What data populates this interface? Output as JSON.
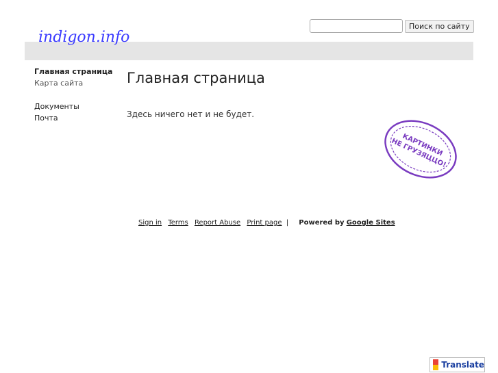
{
  "header": {
    "logo": "indigon.info",
    "search_placeholder": "",
    "search_button": "Поиск по сайту"
  },
  "sidebar": {
    "items": [
      {
        "label": "Главная страница"
      },
      {
        "label": "Карта сайта"
      },
      {
        "label": "Документы"
      },
      {
        "label": "Почта"
      }
    ]
  },
  "main": {
    "title": "Главная страница",
    "text": "Здесь ничего нет и не будет.",
    "stamp_line1": "КАРТИНКИ",
    "stamp_line2": "НЕ ГРУЗЯЦЦО!"
  },
  "footer": {
    "sign_in": "Sign in",
    "terms": "Terms",
    "report_abuse": "Report Abuse",
    "print_page": "Print page",
    "separator": "|",
    "powered_by": "Powered by",
    "google_sites": "Google Sites"
  },
  "translate": {
    "label": "Translate"
  },
  "colors": {
    "stamp": "#7a3cc0",
    "logo": "#3b3bff"
  }
}
